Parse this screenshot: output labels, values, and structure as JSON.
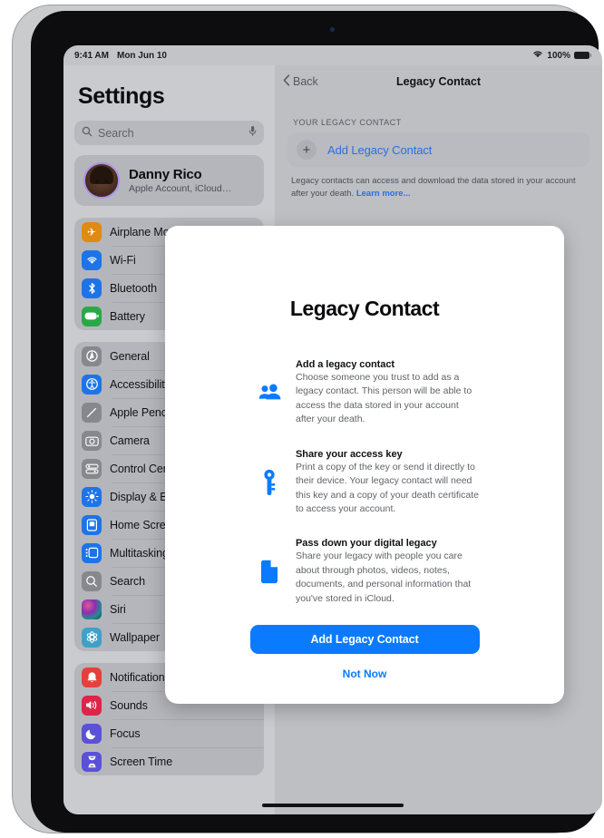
{
  "status_bar": {
    "time": "9:41 AM",
    "date": "Mon Jun 10",
    "battery_percent": "100%",
    "wifi_icon": "wifi-icon",
    "battery_icon": "battery-full-icon"
  },
  "sidebar": {
    "title": "Settings",
    "search": {
      "placeholder": "Search",
      "icon": "search-icon",
      "mic_icon": "microphone-icon"
    },
    "account": {
      "name": "Danny Rico",
      "subtitle": "Apple Account, iCloud…",
      "avatar": "memoji-avatar"
    },
    "groups": [
      {
        "items": [
          {
            "label": "Airplane Mode",
            "icon": "airplane-icon",
            "color": "#e08a12"
          },
          {
            "label": "Wi-Fi",
            "icon": "wifi-icon",
            "color": "#1d74e8"
          },
          {
            "label": "Bluetooth",
            "icon": "bluetooth-icon",
            "color": "#1d74e8"
          },
          {
            "label": "Battery",
            "icon": "battery-icon",
            "color": "#2aa848"
          }
        ]
      },
      {
        "items": [
          {
            "label": "General",
            "icon": "gear-icon",
            "color": "#86888d"
          },
          {
            "label": "Accessibility",
            "icon": "accessibility-icon",
            "color": "#1d74e8"
          },
          {
            "label": "Apple Pencil",
            "icon": "pencil-icon",
            "color": "#86888d"
          },
          {
            "label": "Camera",
            "icon": "camera-icon",
            "color": "#86888d"
          },
          {
            "label": "Control Center",
            "icon": "sliders-icon",
            "color": "#86888d"
          },
          {
            "label": "Display & Brightness",
            "icon": "brightness-icon",
            "color": "#1d74e8"
          },
          {
            "label": "Home Screen & App Library",
            "icon": "home-screen-icon",
            "color": "#1d74e8"
          },
          {
            "label": "Multitasking & Gestures",
            "icon": "multitasking-icon",
            "color": "#1d74e8"
          },
          {
            "label": "Search",
            "icon": "search-icon",
            "color": "#86888d"
          },
          {
            "label": "Siri",
            "icon": "siri-icon",
            "color": "#3a1f4a"
          },
          {
            "label": "Wallpaper",
            "icon": "wallpaper-icon",
            "color": "#3fa0c8"
          }
        ]
      },
      {
        "items": [
          {
            "label": "Notifications",
            "icon": "bell-icon",
            "color": "#e5403a"
          },
          {
            "label": "Sounds",
            "icon": "speaker-icon",
            "color": "#e02449"
          },
          {
            "label": "Focus",
            "icon": "moon-icon",
            "color": "#5b51d8"
          },
          {
            "label": "Screen Time",
            "icon": "hourglass-icon",
            "color": "#5b51d8"
          }
        ]
      }
    ]
  },
  "detail": {
    "back_label": "Back",
    "back_icon": "chevron-left-icon",
    "title": "Legacy Contact",
    "section_header": "YOUR LEGACY CONTACT",
    "add_contact_label": "Add Legacy Contact",
    "plus_icon": "plus-icon",
    "footnote_text": "Legacy contacts can access and download the data stored in your account after your death. ",
    "footnote_link": "Learn more..."
  },
  "modal": {
    "title": "Legacy Contact",
    "features": [
      {
        "icon": "two-people-icon",
        "heading": "Add a legacy contact",
        "body": "Choose someone you trust to add as a legacy contact. This person will be able to access the data stored in your account after your death."
      },
      {
        "icon": "key-icon",
        "heading": "Share your access key",
        "body": "Print a copy of the key or send it directly to their device. Your legacy contact will need this key and a copy of your death certificate to access your account."
      },
      {
        "icon": "document-icon",
        "heading": "Pass down your digital legacy",
        "body": "Share your legacy with people you care about through photos, videos, notes, documents, and personal information that you've stored in iCloud."
      }
    ],
    "primary_button": "Add Legacy Contact",
    "secondary_button": "Not Now",
    "accent_color": "#0a7bff"
  }
}
